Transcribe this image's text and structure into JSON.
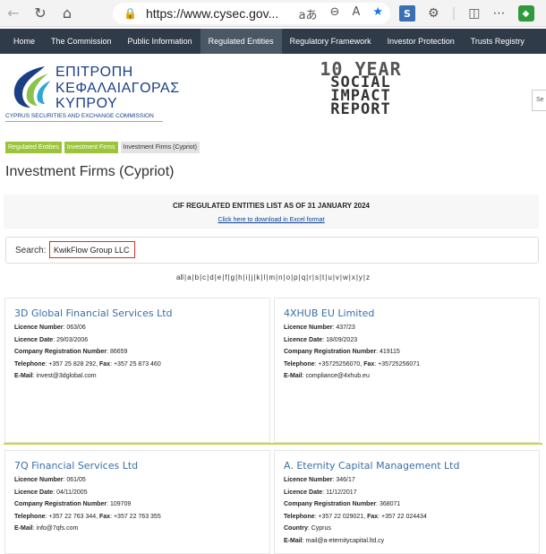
{
  "browser": {
    "url": "https://www.cysec.gov...",
    "reader_label": "aあ",
    "icons": [
      "back-icon",
      "refresh-icon",
      "home-icon",
      "lock-icon",
      "translate-icon",
      "zoom-icon",
      "read-aloud-icon",
      "favorite-star-icon",
      "extensions-icon",
      "split-screen-icon",
      "more-icon"
    ]
  },
  "site_nav": {
    "items": [
      {
        "label": "Home"
      },
      {
        "label": "The Commission"
      },
      {
        "label": "Public Information"
      },
      {
        "label": "Regulated Entities"
      },
      {
        "label": "Regulatory Framework"
      },
      {
        "label": "Investor Protection"
      },
      {
        "label": "Trusts Registry"
      }
    ],
    "active_index": 3
  },
  "header": {
    "logo_lines": [
      "ΕΠΙΤΡΟΠΗ",
      "ΚΕΦΑΛΑΙΑΓΟΡΑΣ",
      "ΚΥΠΡΟΥ"
    ],
    "logo_sub": "CYPRUS SECURITIES AND EXCHANGE COMMISSION",
    "impact_lines": [
      "10 YEAR",
      "SOCIAL",
      "IMPACT",
      "REPORT"
    ],
    "search_tab": "Se"
  },
  "breadcrumb": [
    "Regulated Entities",
    "Investment Firms",
    "Investment Firms (Cypriot)"
  ],
  "page_title": "Investment Firms (Cypriot)",
  "banner": {
    "title": "CIF REGULATED ENTITIES LIST AS OF 31 JANUARY 2024",
    "link": "Click here to download in Excel format"
  },
  "search": {
    "label": "Search:",
    "value": "KwikFlow Group LLC"
  },
  "alphabet": [
    "all",
    "a",
    "b",
    "c",
    "d",
    "e",
    "f",
    "g",
    "h",
    "i",
    "j",
    "k",
    "l",
    "m",
    "n",
    "o",
    "p",
    "q",
    "r",
    "s",
    "t",
    "u",
    "v",
    "w",
    "x",
    "y",
    "z"
  ],
  "cards": [
    {
      "name": "3D Global Financial Services Ltd",
      "licence": "063/06",
      "licence_date": "29/03/2006",
      "reg_number": "86659",
      "telephone": "+357 25 828 292",
      "fax": "+357 25 873 460",
      "email": "invest@3dglobal.com"
    },
    {
      "name": "4XHUB EU Limited",
      "licence": "437/23",
      "licence_date": "18/09/2023",
      "reg_number": "419115",
      "telephone": "+35725256070",
      "fax": "+35725256071",
      "email": "compliance@4xhub.eu"
    },
    {
      "name": "7Q Financial Services Ltd",
      "licence": "061/05",
      "licence_date": "04/11/2005",
      "reg_number": "109709",
      "telephone": "+357 22 763 344",
      "fax": "+357 22 763 355",
      "email": "info@7qfs.com"
    },
    {
      "name": "A. Eternity Capital Management Ltd",
      "licence": "346/17",
      "licence_date": "11/12/2017",
      "reg_number": "368071",
      "telephone": "+357 22 029021",
      "fax": "+357 22 024434",
      "country": "Cyprus",
      "email": "mail@a-eternitycapital.ltd.cy"
    }
  ],
  "labels": {
    "licence": "Licence Number",
    "licence_date": "Licence Date",
    "reg_number": "Company Registration Number",
    "telephone": "Telephone",
    "fax": "Fax",
    "email": "E-Mail",
    "country": "Country"
  },
  "colors": {
    "nav_bg": "#2f3b48",
    "green_crumb": "#9cc43b",
    "card_title": "#3a6fa8",
    "search_highlight": "#d9302c",
    "edge_star": "#1a73e8"
  }
}
